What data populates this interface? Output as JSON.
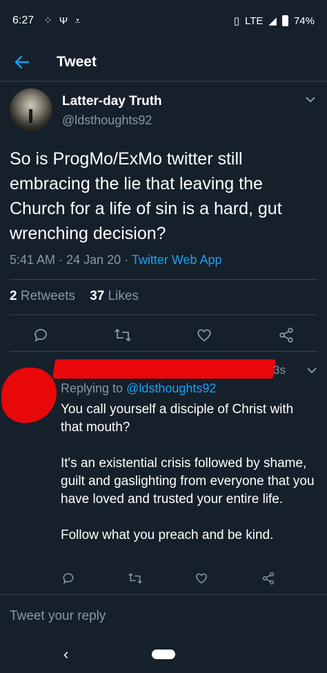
{
  "status_bar": {
    "time": "6:27",
    "left_icons": [
      "signal-dots-icon",
      "antenna-icon",
      "download-done-icon"
    ],
    "network": "LTE",
    "battery": "74%"
  },
  "app_bar": {
    "title": "Tweet"
  },
  "tweet": {
    "author_name": "Latter-day Truth",
    "author_handle": "@ldsthoughts92",
    "text": "So is ProgMo/ExMo twitter still embracing the lie that leaving the Church for a life of sin is a hard, gut wrenching decision?",
    "time": "5:41 AM",
    "date": "24 Jan 20",
    "source": "Twitter Web App",
    "retweets_count": "2",
    "retweets_label": "Retweets",
    "likes_count": "37",
    "likes_label": "Likes"
  },
  "reply": {
    "time_partial": "3s",
    "replying_label": "Replying to",
    "replying_handle": "@ldsthoughts92",
    "paragraphs": [
      "You call yourself a disciple of Christ with that mouth?",
      "It's an existential crisis followed by shame, guilt and gaslighting from everyone that you have loved and trusted your entire life.",
      "Follow what you preach and be kind."
    ]
  },
  "composer": {
    "placeholder": "Tweet your reply"
  },
  "colors": {
    "background": "#15202b",
    "accent": "#1da1f2",
    "muted": "#8899a6",
    "divider": "#38444d",
    "redaction": "#e8080a"
  }
}
